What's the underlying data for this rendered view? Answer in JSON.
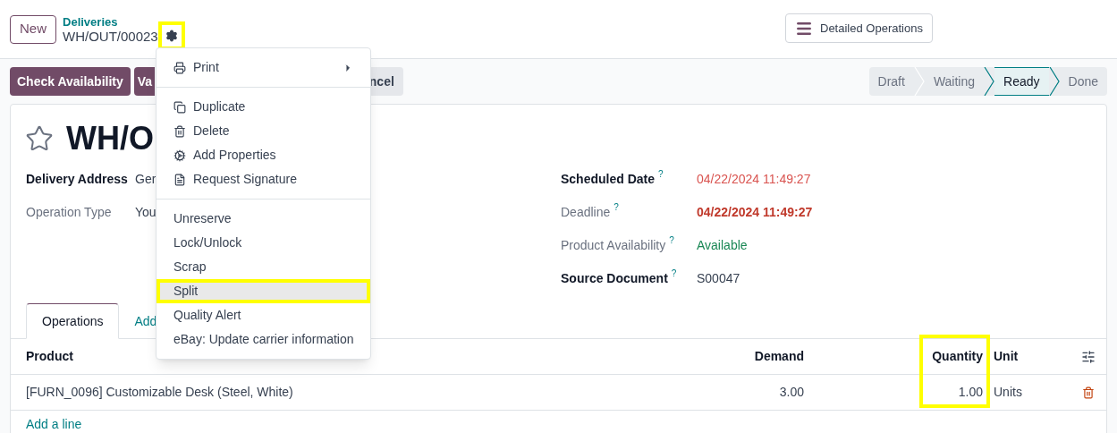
{
  "breadcrumb": {
    "new_button": "New",
    "parent": "Deliveries",
    "current": "WH/OUT/00023",
    "gear_highlighted": true
  },
  "detailed_operations": "Detailed Operations",
  "actions": [
    {
      "label": "Check Availability",
      "kind": "primary"
    },
    {
      "label": "Va",
      "kind": "primary"
    },
    {
      "label": "ncel",
      "kind": "secondary"
    }
  ],
  "stages": [
    {
      "label": "Draft",
      "selected": false
    },
    {
      "label": "Waiting",
      "selected": false
    },
    {
      "label": "Ready",
      "selected": true
    },
    {
      "label": "Done",
      "selected": false
    }
  ],
  "record": {
    "title": "WH/O",
    "starred": false
  },
  "fields_left": [
    {
      "label": "Delivery Address",
      "value": "Ger",
      "label_bold": true
    },
    {
      "label": "Operation Type",
      "value": "You",
      "label_bold": false
    }
  ],
  "fields_right": [
    {
      "label": "Scheduled Date",
      "help": "?",
      "value": "04/22/2024 11:49:27",
      "label_bold": true,
      "value_bold": false,
      "color": "#d9534f"
    },
    {
      "label": "Deadline",
      "help": "?",
      "value": "04/22/2024 11:49:27",
      "label_bold": false,
      "value_bold": true,
      "color": "#c0392b"
    },
    {
      "label": "Product Availability",
      "help": "?",
      "value": "Available",
      "label_bold": false,
      "value_bold": false,
      "color": "#198754"
    },
    {
      "label": "Source Document",
      "help": "?",
      "value": "S00047",
      "label_bold": true,
      "value_bold": false,
      "color": "#374151"
    }
  ],
  "tabs": [
    {
      "label": "Operations",
      "selected": true
    },
    {
      "label": "Add",
      "selected": false
    }
  ],
  "table": {
    "columns": [
      {
        "label": "Product",
        "align_right": false,
        "highlighted": false
      },
      {
        "label": "Demand",
        "align_right": true,
        "highlighted": false
      },
      {
        "label": "Quantity",
        "align_right": true,
        "highlighted": true
      },
      {
        "label": "Unit",
        "align_right": false,
        "highlighted": false
      }
    ],
    "rows": [
      {
        "cells": [
          "[FURN_0096] Customizable Desk (Steel, White)",
          "3.00",
          "1.00",
          "Units"
        ]
      }
    ],
    "add_line": "Add a line"
  },
  "menu": {
    "sections": [
      [
        {
          "label": "Print",
          "submenu": true,
          "highlighted": false
        }
      ],
      [
        {
          "label": "Duplicate",
          "submenu": false,
          "highlighted": false
        },
        {
          "label": "Delete",
          "submenu": false,
          "highlighted": false
        },
        {
          "label": "Add Properties",
          "submenu": false,
          "highlighted": false
        },
        {
          "label": "Request Signature",
          "submenu": false,
          "highlighted": false
        }
      ],
      [
        {
          "label": "Unreserve",
          "submenu": false,
          "highlighted": false
        },
        {
          "label": "Lock/Unlock",
          "submenu": false,
          "highlighted": false
        },
        {
          "label": "Scrap",
          "submenu": false,
          "highlighted": false
        },
        {
          "label": "Split",
          "submenu": false,
          "highlighted": true
        },
        {
          "label": "Quality Alert",
          "submenu": false,
          "highlighted": false
        },
        {
          "label": "eBay: Update carrier information",
          "submenu": false,
          "highlighted": false
        }
      ]
    ]
  }
}
